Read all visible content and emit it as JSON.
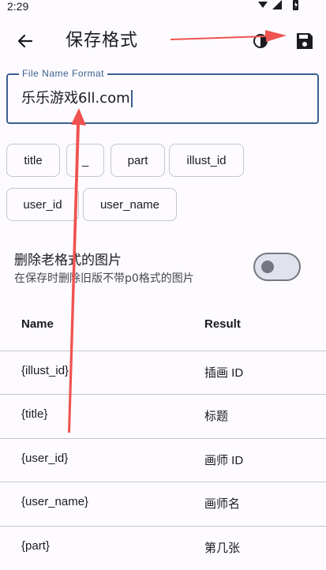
{
  "status_bar": {
    "time": "2:29"
  },
  "app_bar": {
    "title": "保存格式"
  },
  "file_name_field": {
    "label": "File Name Format",
    "value": "乐乐游戏6ll.com"
  },
  "chips": [
    {
      "label": "title"
    },
    {
      "label": "_"
    },
    {
      "label": "part"
    },
    {
      "label": "illust_id"
    },
    {
      "label": "user_id"
    },
    {
      "label": "user_name"
    }
  ],
  "delete_old": {
    "title": "删除老格式的图片",
    "subtitle": "在保存时删除旧版不带p0格式的图片",
    "enabled": false
  },
  "table": {
    "headers": {
      "name": "Name",
      "result": "Result"
    },
    "rows": [
      {
        "name": "{illust_id}",
        "result": "插画 ID"
      },
      {
        "name": "{title}",
        "result": "标题"
      },
      {
        "name": "{user_id}",
        "result": "画师 ID"
      },
      {
        "name": "{user_name}",
        "result": "画师名"
      },
      {
        "name": "{part}",
        "result": "第几张"
      }
    ]
  },
  "colors": {
    "accent": "#3b5f8f",
    "annotation_arrow": "#ef5350",
    "border": "#c4c6cf"
  }
}
